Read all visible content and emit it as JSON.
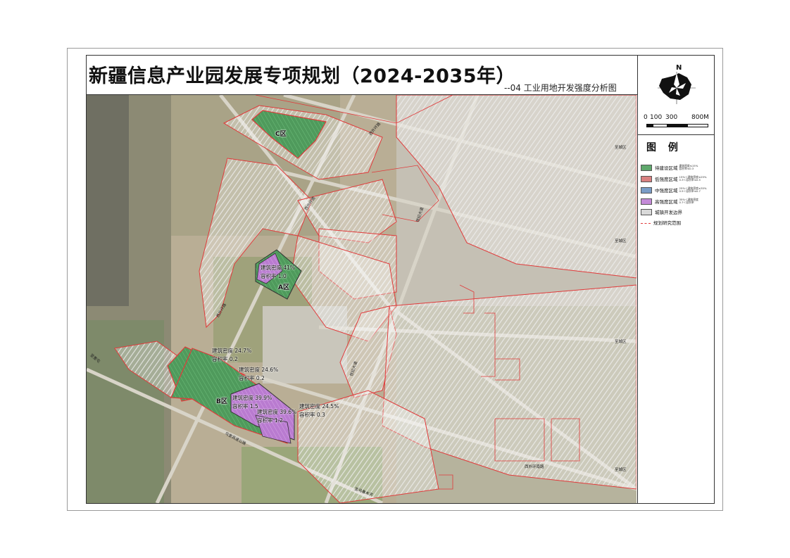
{
  "header": {
    "title": "新疆信息产业园发展专项规划（2024-2035年）",
    "subtitle": "--04 工业用地开发强度分析图"
  },
  "compass": {
    "north_label": "N"
  },
  "scale_bar": {
    "labels": [
      "0",
      "100",
      "300",
      "800M"
    ]
  },
  "legend": {
    "title": "图 例",
    "items": [
      {
        "name": "待建设区域",
        "note": [
          "建筑密度≤15%",
          "容积率≤0.3"
        ],
        "color": "#5fa86c"
      },
      {
        "name": "低强度区域",
        "note": [
          "15%＜建筑密度≤25%",
          "0.3＜容积率≤0.5"
        ],
        "color": "#d98080"
      },
      {
        "name": "中强度区域",
        "note": [
          "25%＜建筑密度≤35%",
          "0.5＜容积率≤0.7"
        ],
        "color": "#7a9cc6"
      },
      {
        "name": "高强度区域",
        "note": [
          "35%＜建筑密度",
          "0.7＜容积率"
        ],
        "color": "#c48ad8"
      },
      {
        "name": "城镇开发边界",
        "note": [],
        "color": "#d9d9d9"
      },
      {
        "name": "规划研究范围",
        "note": [],
        "color": "#e03a3a"
      }
    ]
  },
  "zones": {
    "a": {
      "label": "A区",
      "density": "建筑密度 41%",
      "far": "容积率   1.0"
    },
    "b": {
      "label": "B区"
    },
    "c": {
      "label": "C区"
    }
  },
  "annotations": [
    {
      "density": "建筑密度 24.7%",
      "far": "容积率   0.2"
    },
    {
      "density": "建筑密度 24.6%",
      "far": "容积率   0.2"
    },
    {
      "density": "建筑密度 39.9%",
      "far": "容积率   1.5"
    },
    {
      "density": "建筑密度 39.6%",
      "far": "容积率   1.2"
    },
    {
      "density": "建筑密度 24.5%",
      "far": "容积率   0.3"
    }
  ],
  "roads": [
    "西外环路",
    "西外环路",
    "西外环路",
    "世纪大道",
    "世纪大道",
    "至城区",
    "至城区",
    "至城区",
    "至城区",
    "西外环南路",
    "乌奎高速公路",
    "至乌鲁木齐",
    "至奎屯"
  ]
}
